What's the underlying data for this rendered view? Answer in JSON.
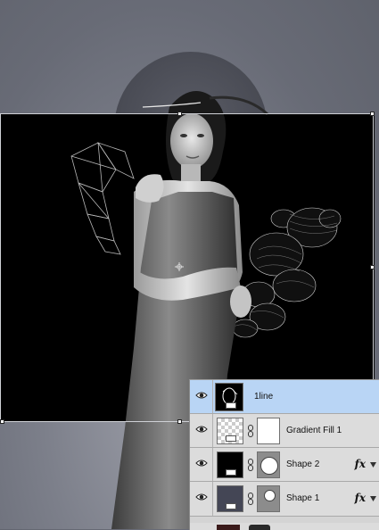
{
  "canvas": {
    "background_color": "#6b6e79",
    "layer_fill_color": "#000000"
  },
  "layers_panel": {
    "selected_color": "#b9d5f5",
    "layers": [
      {
        "name": "1line",
        "thumb": "line-art",
        "selected": true,
        "has_mask": false,
        "has_fx": false,
        "visible_icon": "eye-icon"
      },
      {
        "name": "Gradient Fill 1",
        "thumb": "checker",
        "selected": false,
        "has_mask": true,
        "mask": "white",
        "has_fx": false,
        "visible_icon": "eye-icon"
      },
      {
        "name": "Shape 2",
        "thumb": "black",
        "selected": false,
        "has_mask": true,
        "mask": "circle-large",
        "has_fx": true,
        "visible_icon": "eye-icon"
      },
      {
        "name": "Shape 1",
        "thumb": "navy",
        "selected": false,
        "has_mask": true,
        "mask": "circle-small",
        "has_fx": true,
        "visible_icon": "eye-icon"
      }
    ],
    "fx_label": "fx"
  }
}
